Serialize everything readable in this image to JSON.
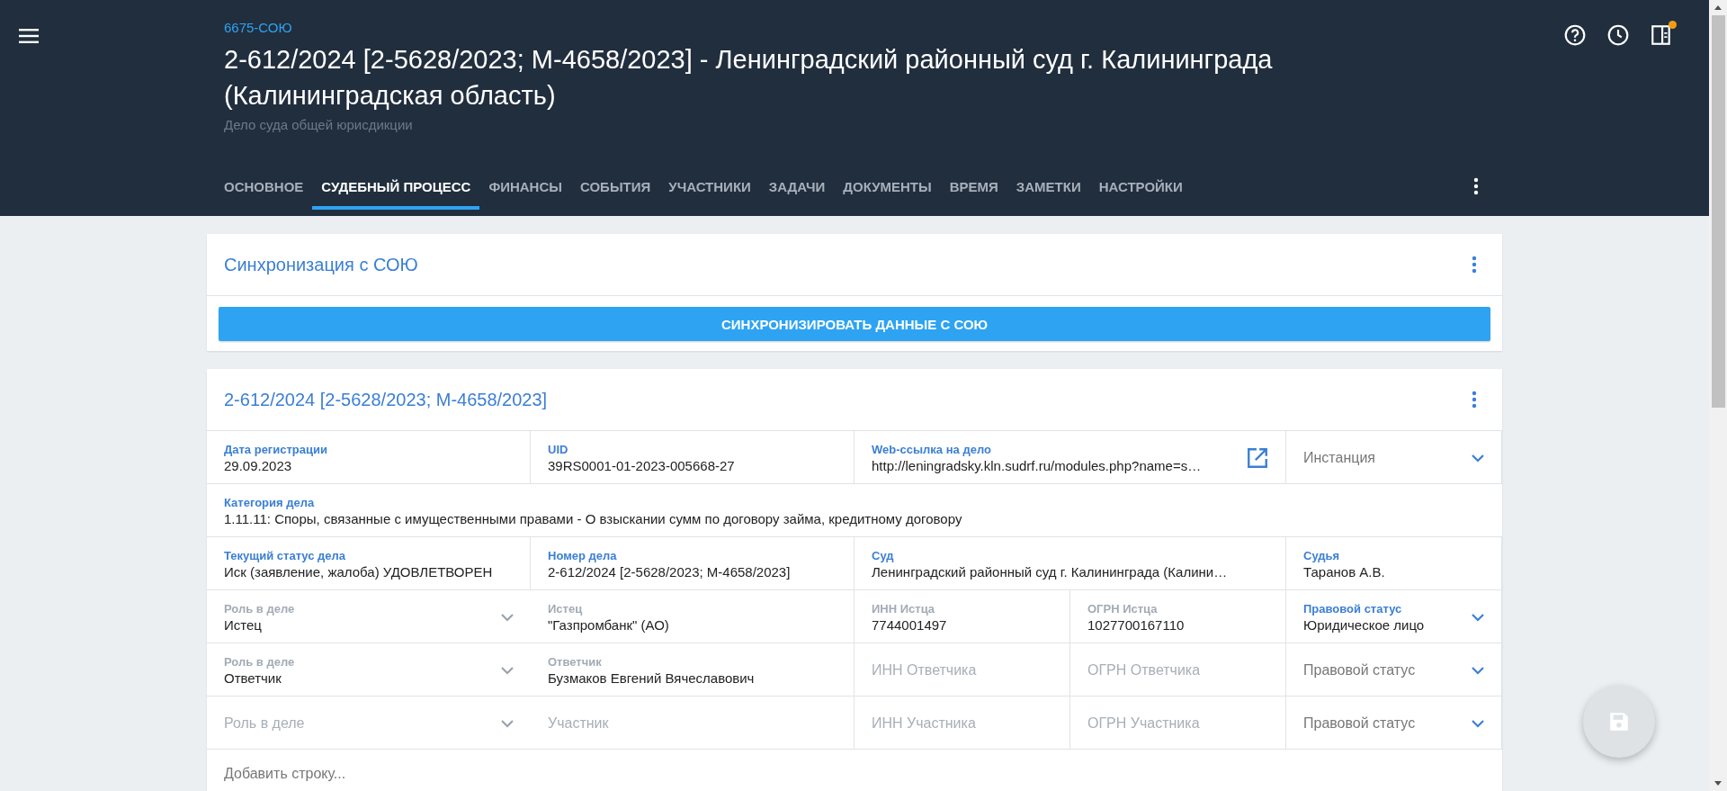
{
  "header": {
    "case_link": "6675-СОЮ",
    "title": "2-612/2024 [2-5628/2023; М-4658/2023] - Ленинградский районный суд г. Калининграда (Калининградская область)",
    "subtitle": "Дело суда общей юрисдикции",
    "notification": true
  },
  "tabs": [
    {
      "label": "ОСНОВНОЕ",
      "selected": false
    },
    {
      "label": "СУДЕБНЫЙ ПРОЦЕСС",
      "selected": true
    },
    {
      "label": "ФИНАНСЫ",
      "selected": false
    },
    {
      "label": "СОБЫТИЯ",
      "selected": false
    },
    {
      "label": "УЧАСТНИКИ",
      "selected": false
    },
    {
      "label": "ЗАДАЧИ",
      "selected": false
    },
    {
      "label": "ДОКУМЕНТЫ",
      "selected": false
    },
    {
      "label": "ВРЕМЯ",
      "selected": false
    },
    {
      "label": "ЗАМЕТКИ",
      "selected": false
    },
    {
      "label": "НАСТРОЙКИ",
      "selected": false
    }
  ],
  "sync_card": {
    "title": "Синхронизация с СОЮ",
    "button": "СИНХРОНИЗИРОВАТЬ ДАННЫЕ С СОЮ"
  },
  "case_card": {
    "title": "2-612/2024 [2-5628/2023; М-4658/2023]",
    "rows": [
      {
        "cells": [
          {
            "kind": "text",
            "label": "Дата регистрации",
            "value": "29.09.2023",
            "disabled": false
          },
          {
            "kind": "text",
            "label": "UID",
            "value": "39RS0001-01-2023-005668-27",
            "disabled": false
          },
          {
            "kind": "link",
            "label": "Web-ссылка на дело",
            "value": "http://leningradsky.kln.sudrf.ru/modules.php?name=s…",
            "disabled": false
          },
          {
            "kind": "select",
            "placeholder": "Инстанция",
            "disabled": false
          }
        ]
      },
      {
        "cells": [
          {
            "kind": "text",
            "label": "Категория дела",
            "value": "1.11.11: Споры, связанные с имущественными правами - О взыскании сумм по договору займа, кредитному договору",
            "disabled": false
          }
        ]
      },
      {
        "cells": [
          {
            "kind": "text",
            "label": "Текущий статус дела",
            "value": "Иск (заявление, жалоба) УДОВЛЕТВОРЕН",
            "disabled": false
          },
          {
            "kind": "text",
            "label": "Номер дела",
            "value": "2-612/2024 [2-5628/2023; М-4658/2023]",
            "disabled": false
          },
          {
            "kind": "text",
            "label": "Суд",
            "value": "Ленинградский районный суд г. Калининграда (Калини…",
            "disabled": false
          },
          {
            "kind": "text",
            "label": "Судья",
            "value": "Таранов А.В.",
            "disabled": false
          }
        ]
      },
      {
        "cells": [
          {
            "kind": "select",
            "label": "Роль в деле",
            "value": "Истец",
            "disabled": true
          },
          {
            "kind": "text",
            "label": "Истец",
            "value": "\"Газпромбанк\" (АО)",
            "disabled": true
          },
          {
            "kind": "text",
            "label": "ИНН Истца",
            "value": "7744001497",
            "disabled": true
          },
          {
            "kind": "text",
            "label": "ОГРН Истца",
            "value": "1027700167110",
            "disabled": true
          },
          {
            "kind": "select",
            "label": "Правовой статус",
            "value": "Юридическое лицо",
            "disabled": false
          }
        ]
      },
      {
        "cells": [
          {
            "kind": "select",
            "label": "Роль в деле",
            "value": "Ответчик",
            "disabled": true
          },
          {
            "kind": "text",
            "label": "Ответчик",
            "value": "Бузмаков Евгений Вячеславович",
            "disabled": true
          },
          {
            "kind": "text",
            "placeholder": "ИНН Ответчика",
            "disabled": true
          },
          {
            "kind": "text",
            "placeholder": "ОГРН Ответчика",
            "disabled": true
          },
          {
            "kind": "select",
            "placeholder": "Правовой статус",
            "disabled": false
          }
        ]
      },
      {
        "cells": [
          {
            "kind": "select",
            "placeholder": "Роль в деле",
            "disabled": true
          },
          {
            "kind": "text",
            "placeholder": "Участник",
            "disabled": true
          },
          {
            "kind": "text",
            "placeholder": "ИНН Участника",
            "disabled": true
          },
          {
            "kind": "text",
            "placeholder": "ОГРН Участника",
            "disabled": true
          },
          {
            "kind": "select",
            "placeholder": "Правовой статус",
            "disabled": false
          }
        ]
      }
    ],
    "add_row": "Добавить строку..."
  }
}
